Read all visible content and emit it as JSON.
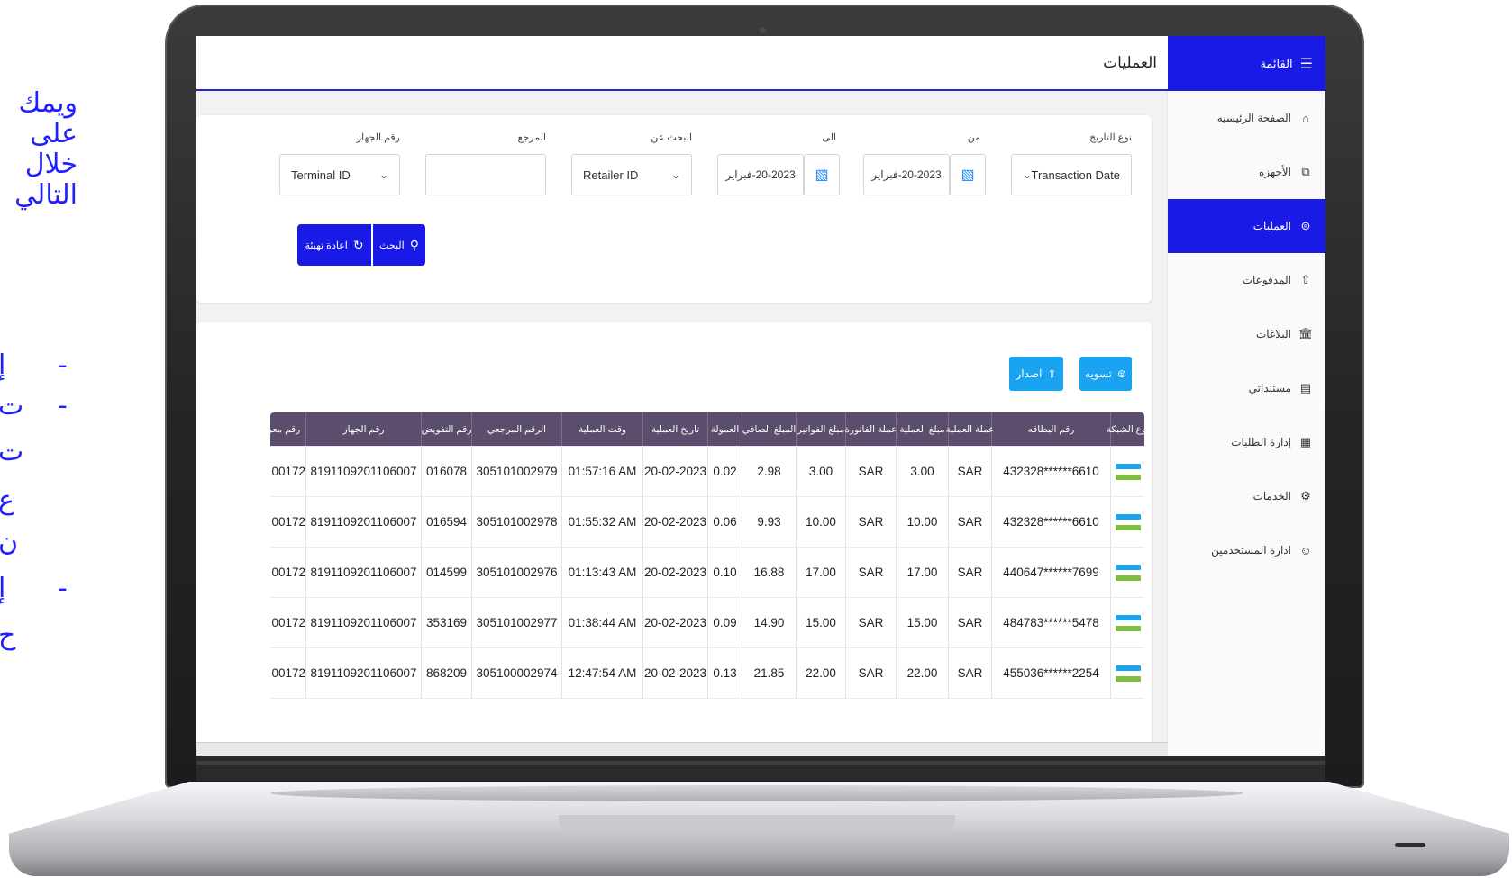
{
  "slide": {
    "lines": [
      "ويمك",
      "على",
      "خلال",
      "التالي"
    ],
    "bullets": [
      {
        "dash": "-",
        "text": "إ"
      },
      {
        "dash": "-",
        "text": "ت"
      },
      {
        "dash": "",
        "text": "ت"
      },
      {
        "dash": "",
        "text": "ع"
      },
      {
        "dash": "",
        "text": "ن"
      },
      {
        "dash": "-",
        "text": "إ"
      },
      {
        "dash": "",
        "text": "ح"
      }
    ]
  },
  "app": {
    "page_title": "العمليات",
    "sidebar": {
      "menu_label": "القائمة",
      "items": [
        {
          "label": "الصفحة الرئيسيه",
          "icon": "home-icon",
          "glyph": "⌂",
          "active": false
        },
        {
          "label": "الأجهزه",
          "icon": "devices-icon",
          "glyph": "⧉",
          "active": false
        },
        {
          "label": "العمليات",
          "icon": "exchange-icon",
          "glyph": "⊜",
          "active": true
        },
        {
          "label": "المدفوعات",
          "icon": "upload-circle-icon",
          "glyph": "⇧",
          "active": false
        },
        {
          "label": "البلاغات",
          "icon": "bank-icon",
          "glyph": "🏛",
          "active": false
        },
        {
          "label": "مستنداتي",
          "icon": "document-icon",
          "glyph": "▤",
          "active": false
        },
        {
          "label": "إدارة الطلبات",
          "icon": "clipboard-icon",
          "glyph": "▦",
          "active": false
        },
        {
          "label": "الخدمات",
          "icon": "gear-icon",
          "glyph": "⚙",
          "active": false
        },
        {
          "label": "ادارة المستخدمين",
          "icon": "users-icon",
          "glyph": "☺",
          "active": false
        }
      ]
    },
    "filters": {
      "date_type_label": "نوع التاريخ",
      "date_type_value": "Transaction Date",
      "from_label": "من",
      "from_value": "20-2023-فبراير",
      "to_label": "الى",
      "to_value": "20-2023-فبراير",
      "search_by_label": "البحث عن",
      "search_by_value": "Retailer ID",
      "reference_label": "المرجع",
      "reference_value": "",
      "terminal_label": "رقم الجهاز",
      "terminal_value": "Terminal ID",
      "search_button": "البحث",
      "reset_button": "اعادة تهيئة"
    },
    "actions": {
      "settle_button": "تسويه",
      "export_button": "اصدار"
    },
    "table": {
      "headers": [
        "نوع الشبكة",
        "رقم البطاقه",
        "عملة العملية",
        "مبلغ العملية",
        "عملة الفاتورة",
        "مبلغ الفواتير",
        "المبلغ الصافي",
        "العمولة",
        "تاريخ العملية",
        "وقت العملية",
        "الرقم المرجعي",
        "رقم التفويض",
        "رقم الجهاز",
        "رقم معرف"
      ],
      "rows": [
        {
          "card": "432328******6610",
          "txn_currency": "SAR",
          "txn_amount": "3.00",
          "bill_currency": "SAR",
          "bill_amount": "3.00",
          "net": "2.98",
          "fee": "0.02",
          "date": "20-02-2023",
          "time": "01:57:16 AM",
          "ref": "305101002979",
          "auth": "016078",
          "terminal": "8191109201106007",
          "id": "00172"
        },
        {
          "card": "432328******6610",
          "txn_currency": "SAR",
          "txn_amount": "10.00",
          "bill_currency": "SAR",
          "bill_amount": "10.00",
          "net": "9.93",
          "fee": "0.06",
          "date": "20-02-2023",
          "time": "01:55:32 AM",
          "ref": "305101002978",
          "auth": "016594",
          "terminal": "8191109201106007",
          "id": "00172"
        },
        {
          "card": "440647******7699",
          "txn_currency": "SAR",
          "txn_amount": "17.00",
          "bill_currency": "SAR",
          "bill_amount": "17.00",
          "net": "16.88",
          "fee": "0.10",
          "date": "20-02-2023",
          "time": "01:13:43 AM",
          "ref": "305101002976",
          "auth": "014599",
          "terminal": "8191109201106007",
          "id": "00172"
        },
        {
          "card": "484783******5478",
          "txn_currency": "SAR",
          "txn_amount": "15.00",
          "bill_currency": "SAR",
          "bill_amount": "15.00",
          "net": "14.90",
          "fee": "0.09",
          "date": "20-02-2023",
          "time": "01:38:44 AM",
          "ref": "305101002977",
          "auth": "353169",
          "terminal": "8191109201106007",
          "id": "00172"
        },
        {
          "card": "455036******2254",
          "txn_currency": "SAR",
          "txn_amount": "22.00",
          "bill_currency": "SAR",
          "bill_amount": "22.00",
          "net": "21.85",
          "fee": "0.13",
          "date": "20-02-2023",
          "time": "12:47:54 AM",
          "ref": "305100002974",
          "auth": "868209",
          "terminal": "8191109201106007",
          "id": "00172"
        }
      ]
    }
  }
}
